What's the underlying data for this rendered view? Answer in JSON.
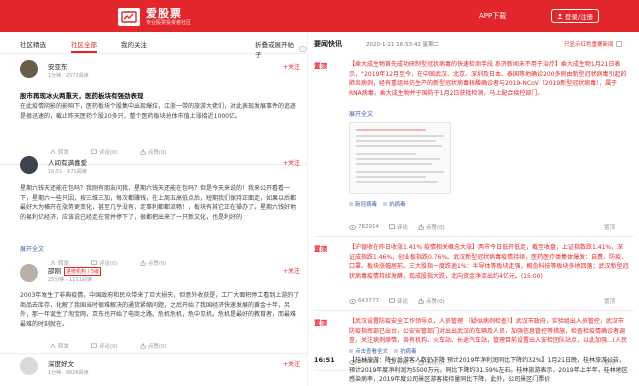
{
  "header": {
    "logo_title": "爱股票",
    "logo_sub": "专业股票投资者社区",
    "app_download": "APP下载",
    "login_register": "登录/注册"
  },
  "left": {
    "tabs": [
      {
        "label": "社区精选"
      },
      {
        "label": "社区全部"
      },
      {
        "label": "我的关注"
      }
    ],
    "active_tab": 1,
    "collapse_label": "折叠或展开帖子",
    "follow_label": "+关注",
    "action_labels": [
      "转发",
      "评论(0)",
      "点赞(0)"
    ],
    "posts": [
      {
        "name": "安亚东",
        "meta": "1分钟 · 2573阅读",
        "badge": "",
        "title": "股市再现冰火两重天，医药板块有强劲表现",
        "body": "在此疫情阴影的影响下，医药板块个股集中出现爆拉，江浙一带的旅游大佬们，对此表现发展事件的追逐是很迅速的，截止昨天医药个股20多只，整个医药板块总体市值上涨接近1000亿。",
        "actions": [
          "转发",
          "评论(0)",
          "点赞(0)"
        ]
      },
      {
        "name": "人间有满喜爱",
        "meta": "16:51 · 671阅读",
        "badge": "",
        "title": "",
        "body": "星期六钱天还能在包吗？我刚有朋友问我，星期六钱天还能在包吗？但是今天来说的！我来公开看看一下，星期六一些只因，按三维三加，每次都赚钱，在上周五高低点后，短期我们保持正面走，如果以后都最好大为横开在涨势更变化，甚至几乎没有，走事利都都流畅！，板块有其它正在操办了。星期六钱好地的易利亿经济，应该说已经走在常并停下了，很都把出来了一只新文化，也是利好的",
        "more": "展开全文",
        "actions": [
          "转发",
          "评论(0)",
          "点赞(0)"
        ]
      },
      {
        "name": "邵刚",
        "meta": "25分钟 · 1111阅读",
        "badge": "进修机构 / 5级",
        "title": "",
        "body": "2003年发生了非典疫情，中国政府和民众带来了巨大损失，但意外收获是，工厂大面积停工看到上游的了商品去库存，化解了我国当时很难解决的通货紧缩问题，之后开始了我国经济快速发展的黄金十年，另外，那一年诞生了淘宝网，京东也开始了电商之路。危机危机，危中见机。危机是最好的教育者，而最难最难的时刻就在。",
        "actions": [
          "转发",
          "评论(0)",
          "点赞(0)"
        ]
      },
      {
        "name": "深度好文",
        "meta": "1分钟 · 8626阅读",
        "badge": "",
        "title": "",
        "body": "",
        "actions": []
      }
    ]
  },
  "right": {
    "title": "要闻快讯",
    "date": "2020-1-21  16:53:42  星期二",
    "filter_label": "只显示红色重要新闻",
    "news": [
      {
        "time": "置顶",
        "text": "【乘大成生物首先成功研制型冠状病毒的快速检测手段 系济新闻未不用于治疗】乘大成生物1月21日表示，“2019年12月至今，在中国武汉、北京、深圳及日本、泰国等地确诊200多例由新型冠状病毒引起的肺炎病例，经有重组共仿生产的新型冠状病毒核酸确诊者与2019-NCoV（2019新型冠状病毒），属于RNA病毒，乘大成生物并于国防于1月2日获批检测，马上配合疾控部门。",
        "more": "展开全文",
        "tags": [
          "新冠病毒",
          "抗病毒"
        ],
        "views": "782914",
        "comments": "评论",
        "likes": "点赞(0)",
        "top_label": "置顶",
        "red": true
      },
      {
        "time": "置顶",
        "text": "【沪银收在昨日收涨1.41% 疫情相关概念大涨】两市今日低开低走，截至收盘，上证指数跌1.41%，深证成指跌1.46%，创业板指跌0.76%。武汉新型冠状病毒疫情持续，医药医疗类集体爆发：自费、防疫、口罩、板块涨幅居前。三大股指一度跌逾1%：半导体等板块走强，概念科技等板块多地回落；武汉新型冠状病毒疫情持续发酵，现成股指大跌，北向资金净流出约4亿元。(15:00)",
        "more": "",
        "tags": [],
        "views": "643777",
        "comments": "评论",
        "likes": "点赞(0)",
        "top_label": "置顶",
        "red": true
      },
      {
        "time": "置顶",
        "text": "【武汉设置防疫安全工作领导点，人员管理 （疑似病例检查）】武汉市政府，实验组出入员管控，武汉市防疫指挥部已出台，公安安管部门对出出武汉的车辆及人员，加强信息管控等措施，检查检疫情确诊者调查，关注病例原情，各有机构、火车站、长途汽车站，管理目前设置出入安检团队站点，以此加强...(人民日报)",
        "more": "",
        "tags": [
          "点击查看全文",
          "抗病毒"
        ],
        "views": "846811",
        "comments": "评论",
        "likes": "点赞(0)",
        "top_label": "置顶",
        "red": true
      },
      {
        "time": "16:51",
        "text": "【桂林旅游：降价后游客人数仍下降 预计2019年净利润同比下降约32%】1月21日晚，桂林旅游公告，预计2019年度净利润为5500万元，同比下降约31.59%左右。桂林旅游表示，2019年上半年，桂林地区感染病率，2019年度公司景区游客接待量同比下降，此外，公司景区门票价",
        "more": "",
        "tags": [],
        "views": "",
        "comments": "",
        "likes": "",
        "top_label": "",
        "red": false
      }
    ]
  },
  "colors": {
    "brand": "#e3262c",
    "link": "#3a5ea8"
  }
}
